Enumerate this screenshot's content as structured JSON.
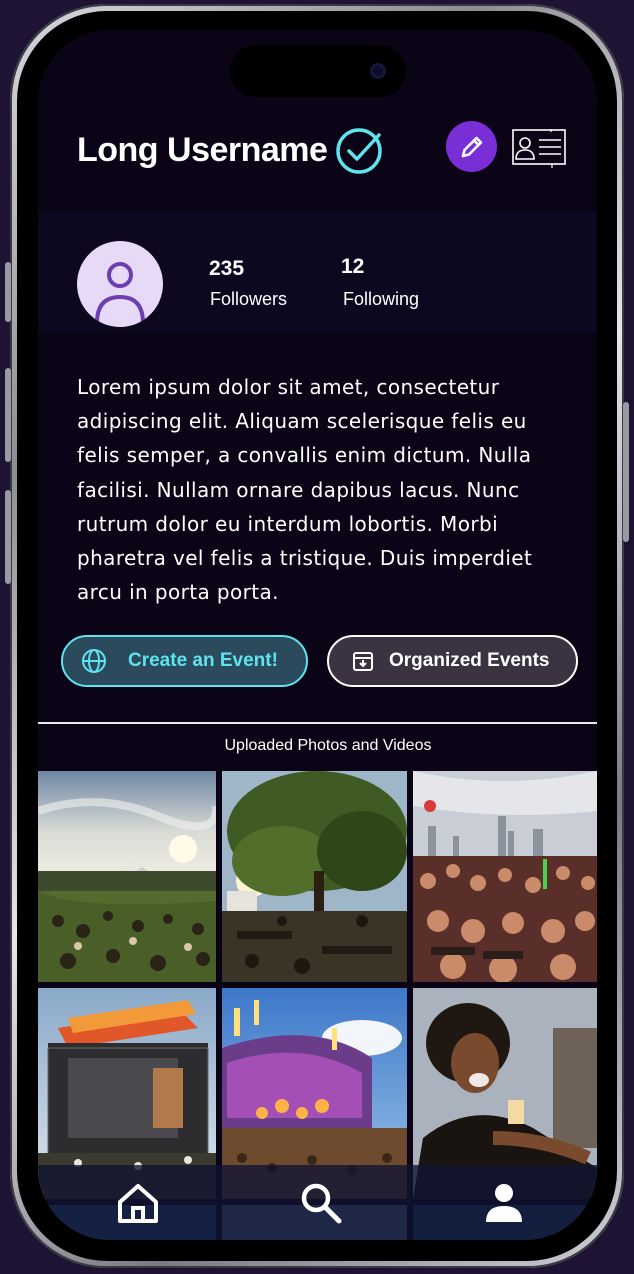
{
  "profile": {
    "username": "Long Username",
    "followers_count": "235",
    "followers_label": "Followers",
    "following_count": "12",
    "following_label": "Following",
    "bio": "Lorem ipsum dolor sit amet, consectetur adipiscing elit. Aliquam scelerisque felis eu felis semper, a convallis enim dictum. Nulla facilisi. Nullam ornare dapibus lacus. Nunc rutrum dolor eu interdum lobortis. Morbi pharetra vel felis a tristique. Duis imperdiet arcu in porta porta."
  },
  "actions": {
    "create_event_label": "Create an Event!",
    "organized_events_label": "Organized Events"
  },
  "gallery": {
    "title": "Uploaded Photos and Videos",
    "items": [
      {
        "icon": "festival-tent-photo"
      },
      {
        "icon": "festival-tree-photo"
      },
      {
        "icon": "crowd-city-photo"
      },
      {
        "icon": "stage-photo"
      },
      {
        "icon": "fireworks-stage-photo"
      },
      {
        "icon": "smiling-woman-photo"
      }
    ]
  },
  "nav": {
    "items": [
      {
        "icon": "home-icon"
      },
      {
        "icon": "search-icon"
      },
      {
        "icon": "profile-icon"
      }
    ]
  },
  "colors": {
    "background": "#0b0416",
    "accent_purple": "#7a2fd6",
    "accent_cyan": "#5fe3ef",
    "avatar_bg": "#e7daf6"
  }
}
